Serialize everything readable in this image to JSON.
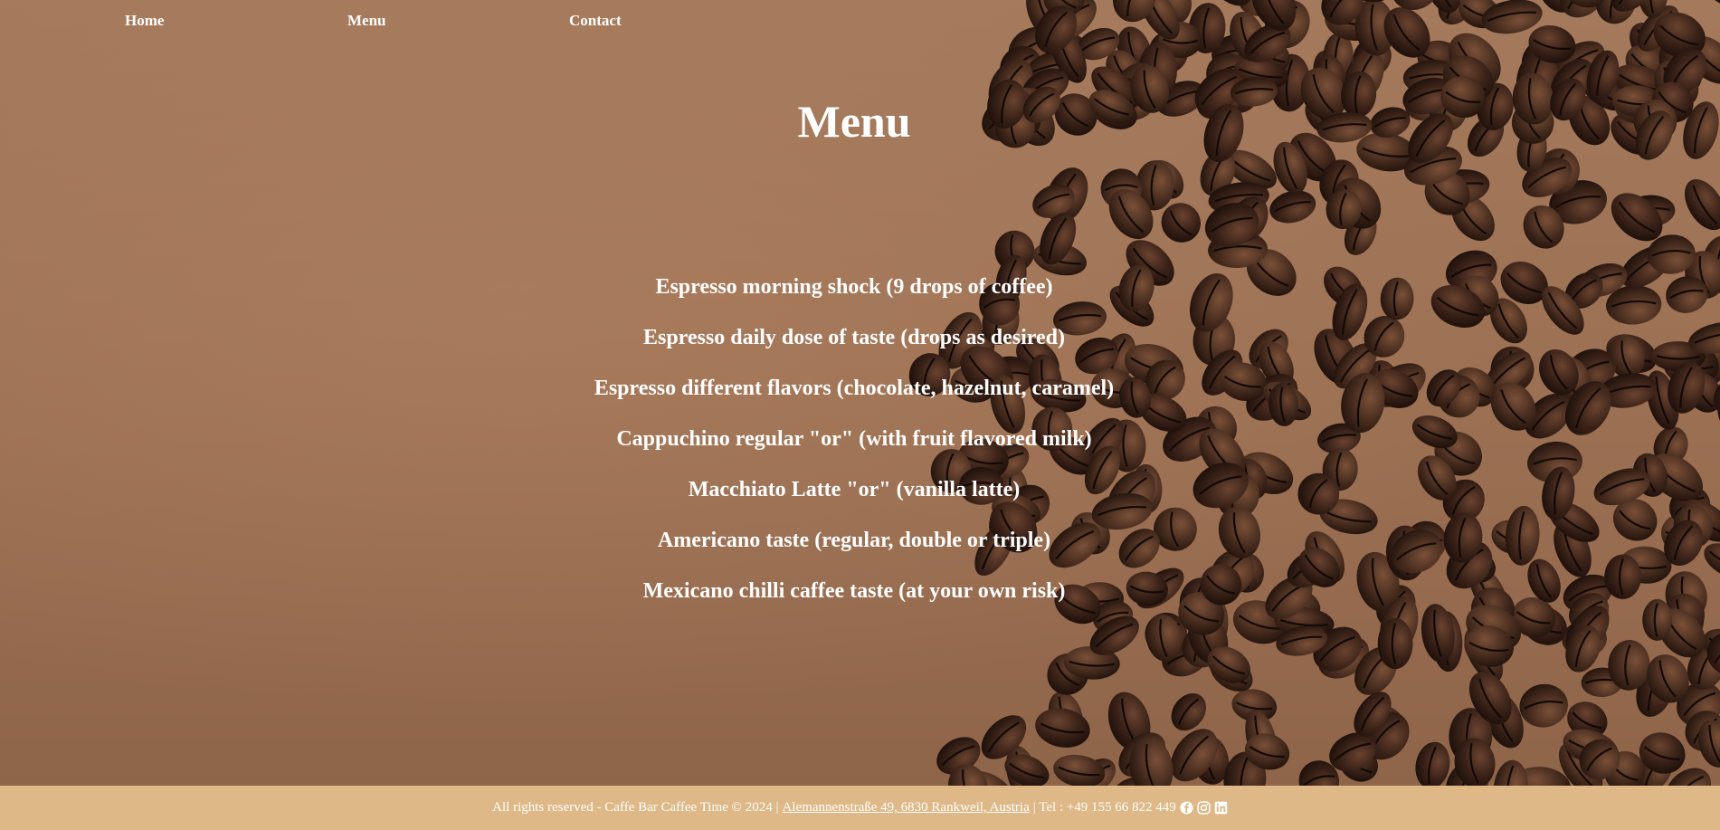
{
  "nav": {
    "home_label": "Home",
    "menu_label": "Menu",
    "contact_label": "Contact"
  },
  "main": {
    "title": "Menu",
    "items": [
      "Espresso morning shock (9 drops of coffee)",
      "Espresso daily dose of taste (drops as desired)",
      "Espresso different flavors (chocolate, hazelnut, caramel)",
      "Cappuchino regular \"or\" (with fruit flavored milk)",
      "Macchiato Latte \"or\" (vanilla latte)",
      "Americano taste (regular, double or triple)",
      "Mexicano chilli caffee taste (at your own risk)"
    ]
  },
  "footer": {
    "copyright": "All rights reserved - Caffe Bar Caffee Time © 2024 |",
    "address": "Alemannenstraße 49, 6830 Rankweil, Austria",
    "phone": "| Tel : +49 155 66 822 449",
    "icons": [
      "facebook-icon",
      "instagram-icon",
      "linkedin-icon"
    ]
  },
  "colors": {
    "footer_bg": "#deb887",
    "text": "#ffffff",
    "background": "#9a6f52"
  }
}
